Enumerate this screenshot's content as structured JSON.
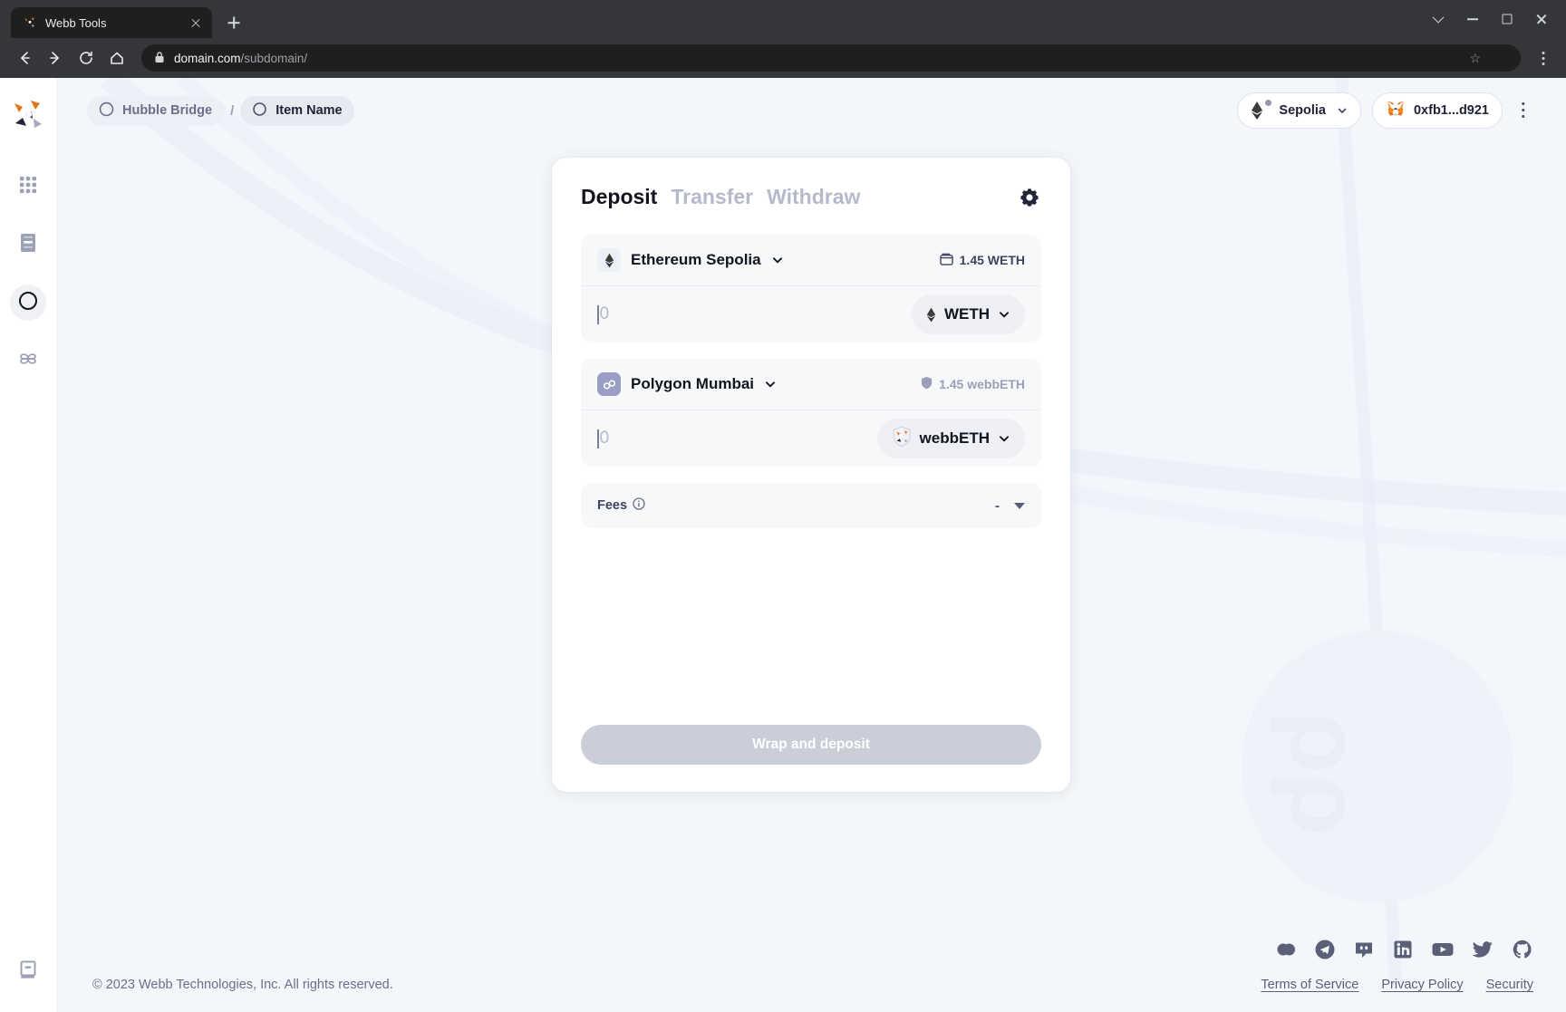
{
  "browser": {
    "tab_title": "Webb Tools",
    "tab_favicon_icon": "webb-logo-icon",
    "new_tab_icon": "plus-icon",
    "back_icon": "arrow-left-icon",
    "forward_icon": "arrow-right-icon",
    "reload_icon": "reload-icon",
    "home_icon": "home-icon",
    "lock_icon": "lock-icon",
    "url_host": "domain.com",
    "url_path": "/subdomain/",
    "bookmark_icon": "star-icon",
    "menu_icon": "vertical-dots-icon",
    "window_chevron_icon": "chevron-down-icon",
    "minimize_icon": "minimize-icon",
    "maximize_icon": "maximize-icon",
    "close_icon": "close-icon"
  },
  "sidebar": {
    "logo_icon": "webb-logo-icon",
    "items": [
      {
        "name": "hubble",
        "icon": "grid-icon",
        "active": false
      },
      {
        "name": "stats",
        "icon": "document-icon",
        "active": false
      },
      {
        "name": "bridge",
        "icon": "bridge-circle-icon",
        "active": true
      },
      {
        "name": "wrap-unwrap",
        "icon": "nodes-icon",
        "active": false
      }
    ],
    "bottom_item": {
      "name": "docs",
      "icon": "book-icon"
    }
  },
  "topbar": {
    "breadcrumb": [
      {
        "label": "Hubble Bridge",
        "icon": "bridge-circle-icon"
      },
      {
        "label": "Item Name",
        "icon": "circle-icon"
      }
    ],
    "separator": "/",
    "network": {
      "label": "Sepolia",
      "icon": "ethereum-icon",
      "chevron_icon": "chevron-down-icon",
      "status_color": "#9299ad"
    },
    "wallet": {
      "address": "0xfb1...d921",
      "icon": "metamask-fox-icon"
    },
    "menu_icon": "vertical-dots-icon"
  },
  "card": {
    "tabs": [
      {
        "label": "Deposit",
        "active": true
      },
      {
        "label": "Transfer",
        "active": false
      },
      {
        "label": "Withdraw",
        "active": false
      }
    ],
    "settings_icon": "gear-icon",
    "source": {
      "chain": "Ethereum Sepolia",
      "chain_icon": "ethereum-icon",
      "chevron_icon": "chevron-down-icon",
      "balance": "1.45 WETH",
      "balance_icon": "wallet-icon",
      "amount_placeholder": "0",
      "amount_value": "",
      "token": "WETH",
      "token_icon": "ethereum-icon",
      "token_chevron_icon": "chevron-down-icon"
    },
    "destination": {
      "chain": "Polygon Mumbai",
      "chain_icon": "polygon-icon",
      "chevron_icon": "chevron-down-icon",
      "balance": "1.45 webbETH",
      "balance_icon": "shield-icon",
      "amount_placeholder": "0",
      "amount_value": "",
      "token": "webbETH",
      "token_icon": "webb-shield-icon",
      "token_chevron_icon": "chevron-down-icon"
    },
    "fees": {
      "label": "Fees",
      "info_icon": "info-icon",
      "value": "-",
      "toggle_icon": "caret-down-icon"
    },
    "action_button": {
      "label": "Wrap and deposit",
      "disabled": true,
      "color": "#c9ced8"
    }
  },
  "footer": {
    "copyright": "© 2023 Webb Technologies, Inc. All rights reserved.",
    "socials": [
      {
        "name": "commit",
        "icon": "commit-icon"
      },
      {
        "name": "telegram",
        "icon": "telegram-icon"
      },
      {
        "name": "discord",
        "icon": "discord-icon"
      },
      {
        "name": "linkedin",
        "icon": "linkedin-icon"
      },
      {
        "name": "youtube",
        "icon": "youtube-icon"
      },
      {
        "name": "twitter",
        "icon": "twitter-icon"
      },
      {
        "name": "github",
        "icon": "github-icon"
      }
    ],
    "links": [
      {
        "label": "Terms of Service"
      },
      {
        "label": "Privacy Policy"
      },
      {
        "label": "Security"
      }
    ]
  }
}
